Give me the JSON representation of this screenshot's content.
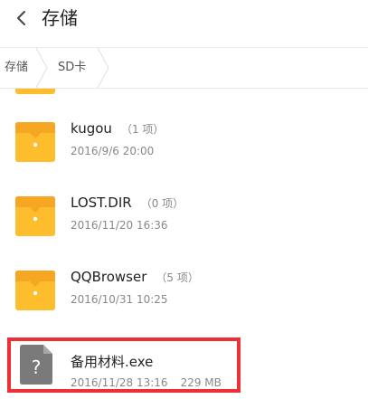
{
  "header": {
    "title": "存储"
  },
  "breadcrumb": {
    "items": [
      {
        "label": "存储"
      },
      {
        "label": "SD卡"
      }
    ]
  },
  "files": [
    {
      "name": "kugou",
      "count": "（1 项）",
      "date": "2016/9/6 20:00",
      "type": "folder"
    },
    {
      "name": "LOST.DIR",
      "count": "（0 项）",
      "date": "2016/11/20 16:36",
      "type": "folder"
    },
    {
      "name": "QQBrowser",
      "count": "（5 项）",
      "date": "2016/10/31 10:25",
      "type": "folder"
    },
    {
      "name": "备用材料.exe",
      "date": "2016/11/28 13:16",
      "size": "229 MB",
      "type": "unknown-file"
    }
  ],
  "colors": {
    "folder": "#fdbd2c",
    "folder_tab": "#f6a623",
    "file_icon": "#7a7a7a",
    "highlight": "#ee2f36"
  }
}
